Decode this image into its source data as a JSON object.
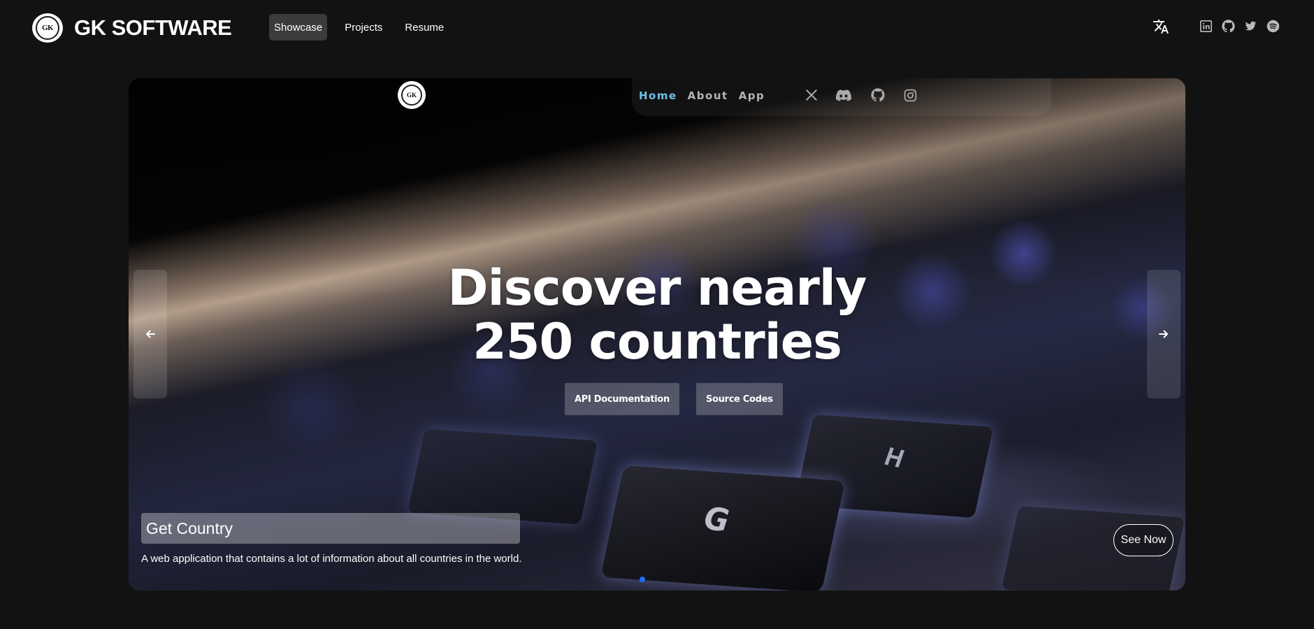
{
  "header": {
    "brand_name": "GK SOFTWARE",
    "logo_text": "GK",
    "nav": [
      {
        "label": "Showcase",
        "active": true
      },
      {
        "label": "Projects",
        "active": false
      },
      {
        "label": "Resume",
        "active": false
      }
    ],
    "translate_icon": "translate-icon",
    "socials": [
      "linkedin-icon",
      "github-icon",
      "twitter-icon",
      "spotify-icon"
    ]
  },
  "slide": {
    "site_logo_text": "GK",
    "site_nav": [
      {
        "label": "Home",
        "active": true
      },
      {
        "label": "About",
        "active": false
      },
      {
        "label": "App",
        "active": false
      }
    ],
    "site_socials": [
      "x-icon",
      "discord-icon",
      "github-icon",
      "instagram-icon"
    ],
    "headline_line1": "Discover nearly",
    "headline_line2": "250 countries",
    "buttons": [
      "API Documentation",
      "Source Codes"
    ],
    "key_labels": [
      "G",
      "H"
    ],
    "caption_title": "Get Country",
    "caption_description": "A web application that contains a lot of information about all countries in the world.",
    "cta": "See Now"
  },
  "carousel": {
    "active_index": 0,
    "indicator_color": "#1e6ff5"
  },
  "colors": {
    "background": "#121212",
    "active_nav": "#3b3b3b",
    "site_nav_active": "#6ec3e3"
  }
}
